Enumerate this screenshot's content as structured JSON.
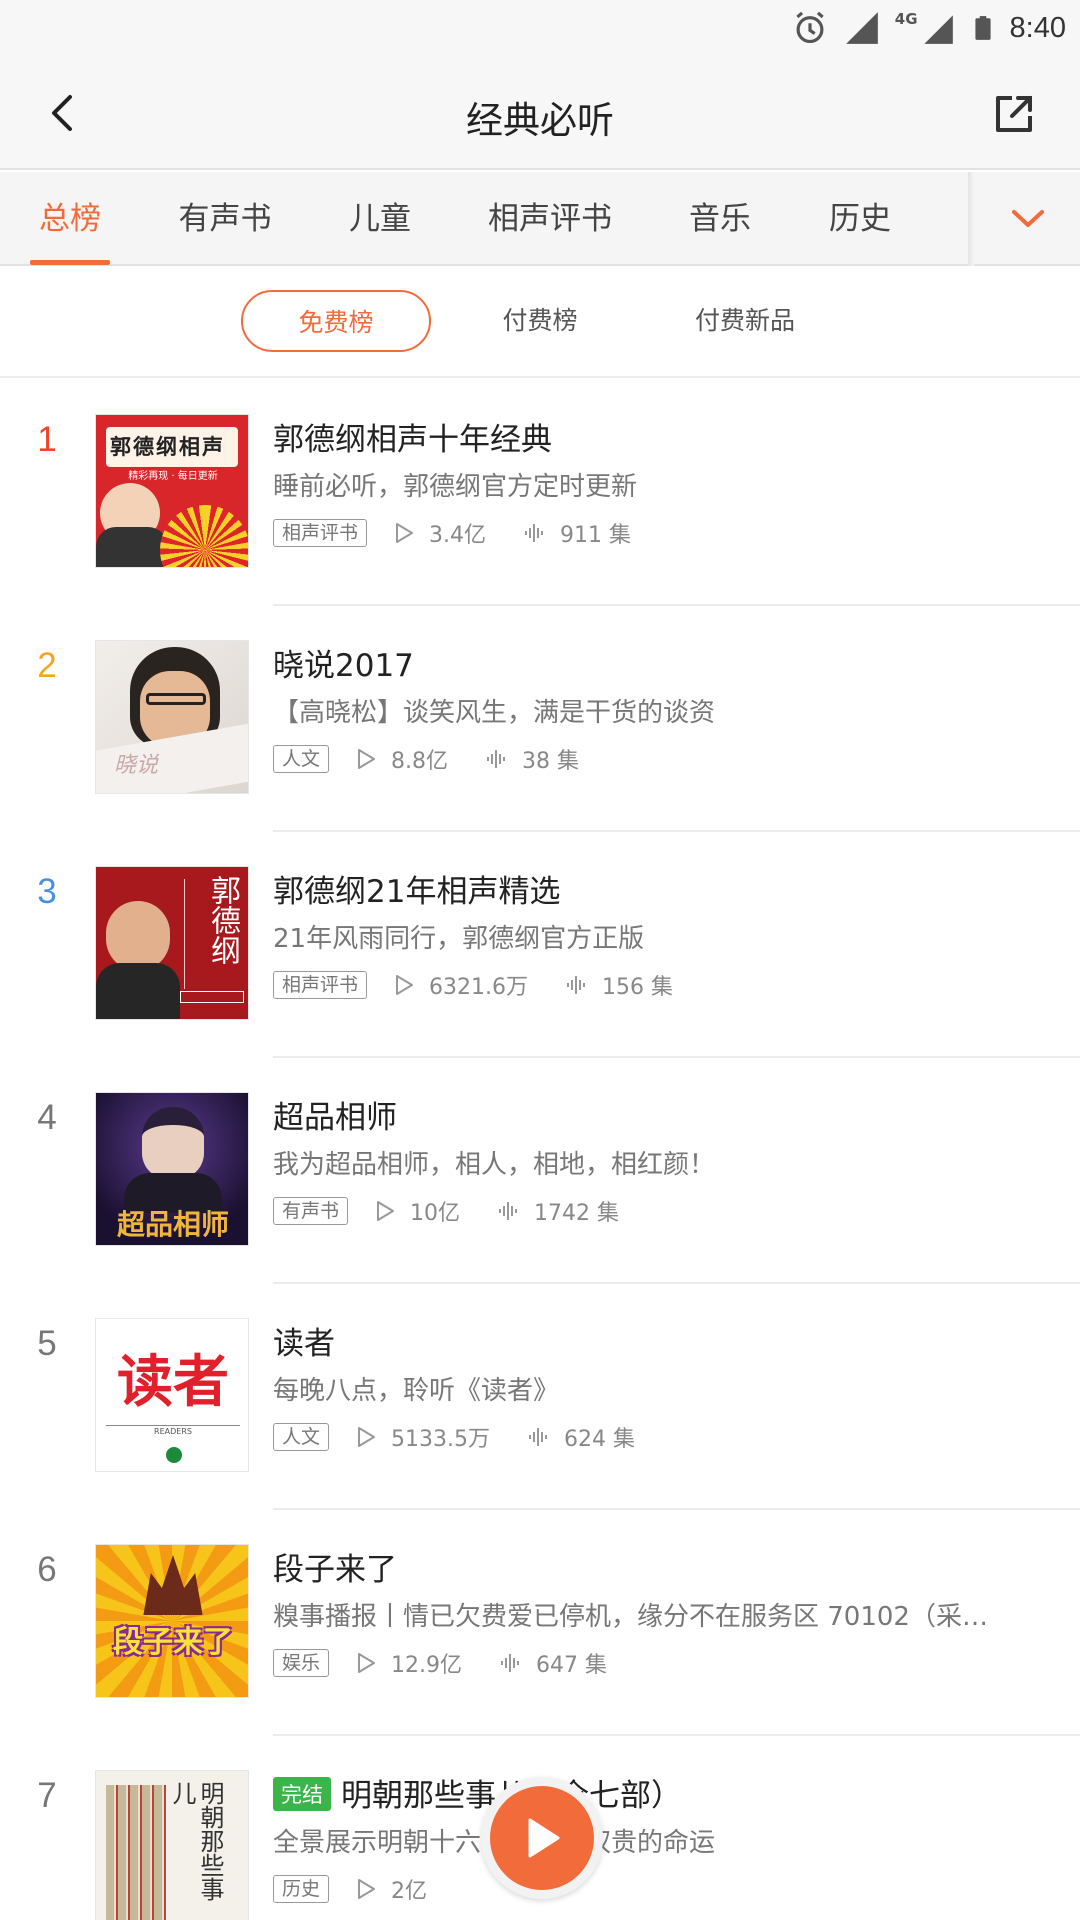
{
  "status_bar": {
    "time": "8:40",
    "network": "4G"
  },
  "header": {
    "title": "经典必听"
  },
  "category_tabs": {
    "items": [
      "总榜",
      "有声书",
      "儿童",
      "相声评书",
      "音乐",
      "历史"
    ],
    "active_index": 0
  },
  "sub_tabs": {
    "items": [
      "免费榜",
      "付费榜",
      "付费新品"
    ],
    "active_index": 0
  },
  "colors": {
    "accent": "#f26b3a",
    "rank1": "#f0442c",
    "rank2": "#f5a623",
    "rank3": "#4a90e2",
    "done_badge": "#3ab54a"
  },
  "list": [
    {
      "rank": "1",
      "title": "郭德纲相声十年经典",
      "desc": "睡前必听，郭德纲官方定时更新",
      "tag": "相声评书",
      "plays": "3.4亿",
      "episodes": "911 集",
      "cover_text": "郭德纲相声",
      "cover_sub": "精彩再现 · 每日更新"
    },
    {
      "rank": "2",
      "title": "晓说2017",
      "desc": "【高晓松】谈笑风生，满是干货的谈资",
      "tag": "人文",
      "plays": "8.8亿",
      "episodes": "38 集",
      "cover_text": "晓说"
    },
    {
      "rank": "3",
      "title": "郭德纲21年相声精选",
      "desc": "21年风雨同行，郭德纲官方正版",
      "tag": "相声评书",
      "plays": "6321.6万",
      "episodes": "156 集",
      "cover_text": "郭德纲"
    },
    {
      "rank": "4",
      "title": "超品相师",
      "desc": "我为超品相师，相人，相地，相红颜！",
      "tag": "有声书",
      "plays": "10亿",
      "episodes": "1742 集",
      "cover_text": "超品相师"
    },
    {
      "rank": "5",
      "title": "读者",
      "desc": "每晚八点，聆听《读者》",
      "tag": "人文",
      "plays": "5133.5万",
      "episodes": "624 集",
      "cover_text": "读者",
      "cover_sub": "READERS"
    },
    {
      "rank": "6",
      "title": "段子来了",
      "desc": "糗事播报丨情已欠费爱已停机，缘分不在服务区 70102（采…",
      "tag": "娱乐",
      "plays": "12.9亿",
      "episodes": "647 集",
      "cover_text": "段子来了"
    },
    {
      "rank": "7",
      "badge": "完结",
      "title": "明朝那些事儿（全七部）",
      "desc": "全景展示明朝十六帝和王公权贵的命运",
      "tag": "历史",
      "plays": "2亿",
      "cover_text": "明朝那些事儿"
    }
  ]
}
